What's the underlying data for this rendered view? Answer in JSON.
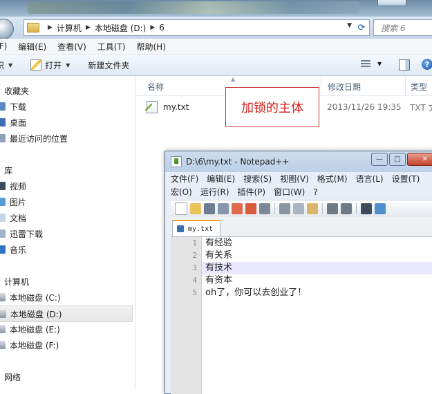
{
  "explorer": {
    "address": {
      "crumbs": [
        "计算机",
        "本地磁盘 (D:)",
        "6"
      ]
    },
    "search_placeholder": "搜索 6",
    "menu": [
      "(F)",
      "编辑(E)",
      "查看(V)",
      "工具(T)",
      "帮助(H)"
    ],
    "toolbar": {
      "lib_label": "织",
      "open_label": "打开",
      "new_folder_label": "新建文件夹",
      "help_label": "?"
    },
    "nav": {
      "favorites_header": "收藏夹",
      "favorites": [
        "下载",
        "桌面",
        "最近访问的位置"
      ],
      "libraries_header": "库",
      "libraries": [
        "视频",
        "图片",
        "文档",
        "迅雷下载",
        "音乐"
      ],
      "computer_header": "计算机",
      "drives": [
        "本地磁盘 (C:)",
        "本地磁盘 (D:)",
        "本地磁盘 (E:)",
        "本地磁盘 (F:)"
      ],
      "network_header": "网络"
    },
    "columns": {
      "name": "名称",
      "date": "修改日期",
      "type": "类型"
    },
    "files": [
      {
        "name": "my.txt",
        "date": "2013/11/26 19:35",
        "type": "TXT 文"
      }
    ]
  },
  "annotation": {
    "text": "加锁的主体",
    "color": "#d42020"
  },
  "notepad": {
    "title": "D:\\6\\my.txt - Notepad++",
    "menu_row1": [
      "文件(F)",
      "编辑(E)",
      "搜索(S)",
      "视图(V)",
      "格式(M)",
      "语言(L)",
      "设置(T)"
    ],
    "menu_row2": [
      "宏(O)",
      "运行(R)",
      "插件(P)",
      "窗口(W)",
      "?"
    ],
    "tab_label": "my.txt",
    "lines": [
      {
        "num": "1",
        "text": "有经验"
      },
      {
        "num": "2",
        "text": "有关系"
      },
      {
        "num": "3",
        "text": "有技术"
      },
      {
        "num": "4",
        "text": "有资本"
      },
      {
        "num": "5",
        "text": "oh了，你可以去创业了！"
      }
    ]
  }
}
